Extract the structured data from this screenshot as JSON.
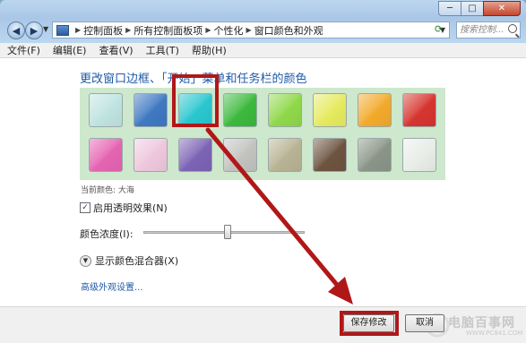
{
  "window": {
    "controls": {
      "minimize": "─",
      "maximize": "□",
      "close": "✕"
    }
  },
  "navigation": {
    "back": "◀",
    "forward": "▶",
    "breadcrumbs": [
      "控制面板",
      "所有控制面板项",
      "个性化",
      "窗口颜色和外观"
    ],
    "search_placeholder": "搜索控制..."
  },
  "menu": [
    "文件(F)",
    "编辑(E)",
    "查看(V)",
    "工具(T)",
    "帮助(H)"
  ],
  "main": {
    "heading": "更改窗口边框、「开始」菜单和任务栏的颜色",
    "swatches": [
      {
        "name": "sky",
        "color": "#bfe3e0"
      },
      {
        "name": "twilight",
        "color": "#3f78c2"
      },
      {
        "name": "sea",
        "color": "#2ac6cf"
      },
      {
        "name": "leaf",
        "color": "#3cb93c"
      },
      {
        "name": "lime",
        "color": "#8fd84a"
      },
      {
        "name": "lemon",
        "color": "#e6ea5f"
      },
      {
        "name": "pumpkin",
        "color": "#f2aa2c"
      },
      {
        "name": "ruby",
        "color": "#d6352f"
      },
      {
        "name": "fuchsia",
        "color": "#e564b2"
      },
      {
        "name": "blush",
        "color": "#eec7dc"
      },
      {
        "name": "violet",
        "color": "#7c63b5"
      },
      {
        "name": "lavender",
        "color": "#c2c2bf"
      },
      {
        "name": "taupe",
        "color": "#b7b393"
      },
      {
        "name": "chocolate",
        "color": "#6d5440"
      },
      {
        "name": "slate",
        "color": "#8a9588"
      },
      {
        "name": "frost",
        "color": "#e8ede8"
      }
    ],
    "selected_index": 2,
    "current_color_label": "当前颜色: 大海",
    "transparency_label": "启用透明效果(N)",
    "transparency_checked": "✓",
    "intensity_label": "颜色浓度(I):",
    "intensity_level": 0.52,
    "mixer_label": "显示颜色混合器(X)",
    "advanced_link": "高级外观设置..."
  },
  "footer": {
    "save_label": "保存修改",
    "cancel_label": "取消"
  },
  "watermark": {
    "text": "电脑百事网",
    "sub": "WWW.PC841.COM"
  },
  "colors": {
    "accent_red": "#b01818",
    "link_blue": "#1e5aa8"
  }
}
